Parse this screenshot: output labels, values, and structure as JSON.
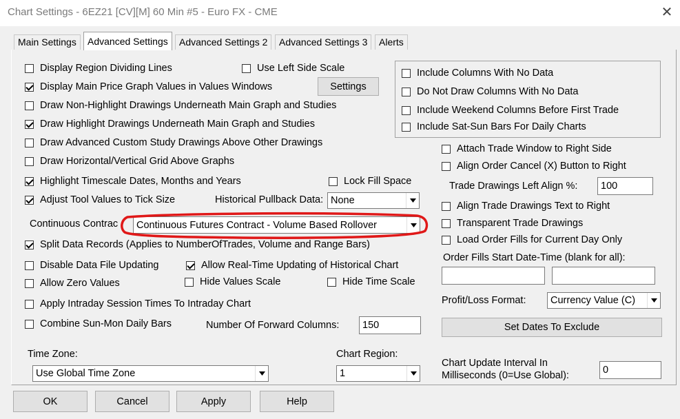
{
  "window": {
    "title": "Chart Settings - 6EZ21 [CV][M]  60 Min  #5 - Euro FX - CME",
    "close_glyph": "✕"
  },
  "tabs": [
    {
      "label": "Main Settings",
      "active": false
    },
    {
      "label": "Advanced Settings",
      "active": true
    },
    {
      "label": "Advanced Settings 2",
      "active": false
    },
    {
      "label": "Advanced Settings 3",
      "active": false
    },
    {
      "label": "Alerts",
      "active": false
    }
  ],
  "left": {
    "display_region_dividing_lines": {
      "label": "Display Region Dividing Lines",
      "checked": false
    },
    "use_left_side_scale": {
      "label": "Use Left Side Scale",
      "checked": false
    },
    "display_main_price_values": {
      "label": "Display Main Price Graph Values in Values Windows",
      "checked": true
    },
    "settings_button": "Settings",
    "draw_non_highlight": {
      "label": "Draw Non-Highlight Drawings Underneath Main Graph and Studies",
      "checked": false
    },
    "draw_highlight": {
      "label": "Draw Highlight Drawings Underneath Main Graph and Studies",
      "checked": true
    },
    "draw_advanced_custom": {
      "label": "Draw Advanced Custom Study Drawings Above Other Drawings",
      "checked": false
    },
    "draw_grid_above": {
      "label": "Draw Horizontal/Vertical Grid Above Graphs",
      "checked": false
    },
    "highlight_timescale": {
      "label": "Highlight Timescale Dates, Months and Years",
      "checked": true
    },
    "lock_fill_space": {
      "label": "Lock Fill Space",
      "checked": false
    },
    "adjust_tool_values": {
      "label": "Adjust Tool Values to Tick Size",
      "checked": true
    },
    "historical_pullback_label": "Historical Pullback Data:",
    "historical_pullback_value": "None",
    "continuous_contract_label": "Continuous Contrac",
    "continuous_contract_value": "Continuous Futures Contract - Volume Based Rollover",
    "split_data_records": {
      "label": "Split Data Records (Applies to NumberOfTrades, Volume and Range Bars)",
      "checked": true
    },
    "disable_data_file_updating": {
      "label": "Disable Data File Updating",
      "checked": false
    },
    "allow_realtime_updating": {
      "label": "Allow Real-Time Updating of Historical Chart",
      "checked": true
    },
    "allow_zero_values": {
      "label": "Allow Zero Values",
      "checked": false
    },
    "hide_values_scale": {
      "label": "Hide Values Scale",
      "checked": false
    },
    "hide_time_scale": {
      "label": "Hide Time Scale",
      "checked": false
    },
    "apply_intraday_session": {
      "label": "Apply Intraday Session Times To Intraday Chart",
      "checked": false
    },
    "combine_sun_mon": {
      "label": "Combine Sun-Mon Daily Bars",
      "checked": false
    },
    "forward_columns_label": "Number Of Forward Columns:",
    "forward_columns_value": "150",
    "time_zone_label": "Time Zone:",
    "time_zone_value": "Use Global Time Zone",
    "chart_region_label": "Chart Region:",
    "chart_region_value": "1"
  },
  "right": {
    "include_columns_no_data": {
      "label": "Include Columns With No Data",
      "checked": false
    },
    "do_not_draw_columns": {
      "label": "Do Not Draw Columns With No Data",
      "checked": false
    },
    "include_weekend_columns": {
      "label": "Include Weekend Columns Before First Trade",
      "checked": false
    },
    "include_sat_sun_bars": {
      "label": "Include Sat-Sun Bars For Daily Charts",
      "checked": false
    },
    "attach_trade_window": {
      "label": "Attach Trade Window to Right Side",
      "checked": false
    },
    "align_order_cancel": {
      "label": "Align Order Cancel (X) Button to Right",
      "checked": false
    },
    "trade_drawings_left_align_label": "Trade Drawings Left Align %:",
    "trade_drawings_left_align_value": "100",
    "align_trade_drawings_text": {
      "label": "Align Trade Drawings Text to Right",
      "checked": false
    },
    "transparent_trade_drawings": {
      "label": "Transparent Trade Drawings",
      "checked": false
    },
    "load_order_fills": {
      "label": "Load Order Fills for Current Day Only",
      "checked": false
    },
    "order_fills_start_label": "Order Fills Start Date-Time (blank for all):",
    "order_fills_start_value": "",
    "order_fills_end_value": "",
    "profit_loss_label": "Profit/Loss Format:",
    "profit_loss_value": "Currency Value (C)",
    "set_dates_button": "Set Dates To Exclude",
    "update_interval_label_1": "Chart Update Interval In",
    "update_interval_label_2": "Milliseconds (0=Use Global):",
    "update_interval_value": "0"
  },
  "footer": {
    "ok": "OK",
    "cancel": "Cancel",
    "apply": "Apply",
    "help": "Help"
  },
  "colors": {
    "annotation": "#e01818",
    "title_text": "#7a7a7a",
    "dialog_bg": "#f0f0f0"
  }
}
